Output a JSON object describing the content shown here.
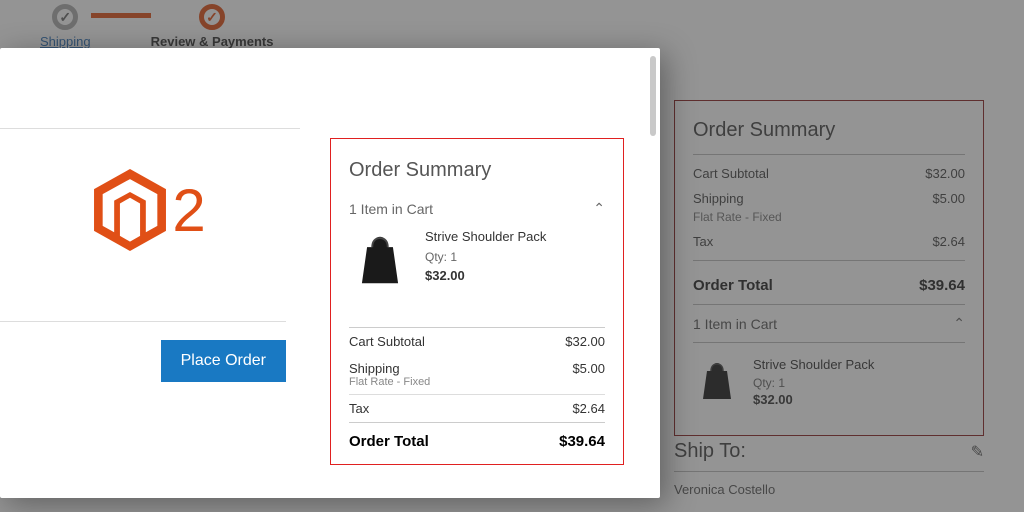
{
  "progress": {
    "shipping": "Shipping",
    "review": "Review & Payments"
  },
  "logo": {
    "digit": "2"
  },
  "place_order_label": "Place Order",
  "summary": {
    "title": "Order Summary",
    "cart_header": "1 Item in Cart",
    "item": {
      "name": "Strive Shoulder Pack",
      "qty_label": "Qty: 1",
      "price": "$32.00"
    },
    "lines": {
      "subtotal_label": "Cart Subtotal",
      "subtotal_value": "$32.00",
      "shipping_label": "Shipping",
      "shipping_value": "$5.00",
      "shipping_method": "Flat Rate - Fixed",
      "tax_label": "Tax",
      "tax_value": "$2.64",
      "total_label": "Order Total",
      "total_value": "$39.64"
    }
  },
  "ship_to": {
    "heading": "Ship To:",
    "name": "Veronica Costello"
  },
  "colors": {
    "accent": "#e04f16",
    "primary_btn": "#1979c3",
    "highlight_border": "#e02020"
  }
}
